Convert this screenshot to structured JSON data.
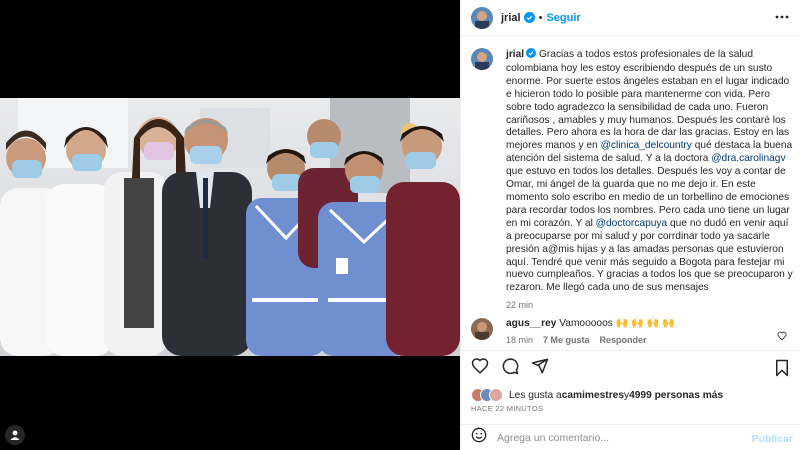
{
  "post": {
    "username": "jrial",
    "follow_label": "Seguir",
    "dot": "•"
  },
  "caption": {
    "username": "jrial",
    "parts": [
      {
        "t": "text",
        "v": " Gracias a todos estos profesionales de la salud colombiana hoy les estoy escribiendo después de un susto enorme. Por suerte estos ángeles estaban en el lugar indicado e hicieron todo lo posible para mantenerme con vida. Pero sobre todo agradezco la sensibilidad de cada uno. Fueron cariñosos , amables y muy humanos. Después les contaré los detalles. Pero ahora es la hora de dar las gracias. Estoy en las mejores manos y en "
      },
      {
        "t": "mention",
        "v": "@clinica_delcountry"
      },
      {
        "t": "text",
        "v": " qué destaca la buena atención del sistema de salud. Y a la doctora "
      },
      {
        "t": "mention",
        "v": "@dra.carolinagv"
      },
      {
        "t": "text",
        "v": " que estuvo en todos los detalles. Después les voy a contar de Omar, mi ángel de la guarda que no me dejo ir. En este momento solo escribo en medio de un torbellino de emociones para recordar todos los nombres. Pero cada uno tiene un lugar en mi corazón. Y al "
      },
      {
        "t": "mention",
        "v": "@doctorcapuya"
      },
      {
        "t": "text",
        "v": " que no dudó en venir aquí a preocuparse por mi salud y por corrdinar todo ya sacarle presión a@mis hijas y a las amadas personas que estuvieron aquí. Tendré que venir más seguido a Bogota para festejar mi nuevo cumpleaños. Y gracias a todos los que se preocuparon y rezaron. Me llegó cada uno de sus mensajes"
      }
    ],
    "time": "22 min"
  },
  "comment": {
    "username": "agus__rey",
    "text": " Vamooooos 🙌 🙌 🙌 🙌",
    "time": "18 min",
    "likes": "7 Me gusta",
    "reply": "Responder"
  },
  "likes": {
    "prefix": "Les gusta a ",
    "user": "camimestres",
    "mid": " y ",
    "others": "4999 personas más"
  },
  "posted_ago": "HACE 22 MINUTOS",
  "add_comment": {
    "placeholder": "Agrega un comentario...",
    "publish": "Publicar"
  },
  "icons": {
    "verified": "verified-badge-icon",
    "more": "more-options-icon",
    "heart": "heart-icon",
    "comment": "comment-icon",
    "share": "share-icon",
    "save": "bookmark-icon",
    "emoji": "emoji-icon",
    "tag": "user-tag-icon"
  },
  "colors": {
    "link": "#0095f6",
    "mention": "#00376b",
    "publish_disabled": "#b2dffc",
    "muted": "#737373"
  }
}
